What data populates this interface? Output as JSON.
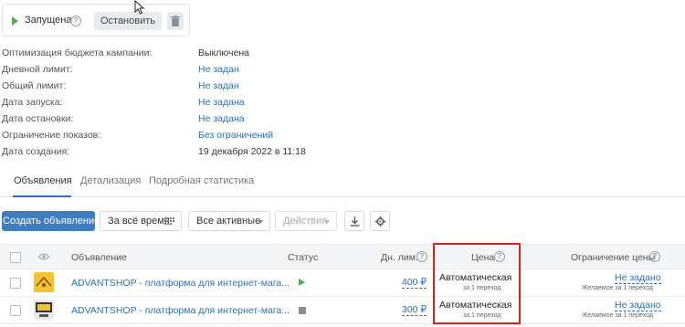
{
  "status": {
    "label": "Запущена",
    "help_icon": "?",
    "stop_label": "Остановить",
    "trash_icon": "trash-icon",
    "play_color": "#4caf50"
  },
  "info": [
    {
      "key": "Оптимизация бюджета кампании:",
      "value": "Выключена",
      "link": false
    },
    {
      "key": "Дневной лимит:",
      "value": "Не задан",
      "link": true
    },
    {
      "key": "Общий лимит:",
      "value": "Не задан",
      "link": true
    },
    {
      "key": "Дата запуска:",
      "value": "Не задана",
      "link": true
    },
    {
      "key": "Дата остановки:",
      "value": "Не задана",
      "link": true
    },
    {
      "key": "Ограничение показов:",
      "value": "Без ограничений",
      "link": true
    },
    {
      "key": "Дата создания:",
      "value": "19 декабря 2022 в 11:18",
      "link": false
    }
  ],
  "tabs": [
    "Объявления",
    "Детализация",
    "Подробная статистика"
  ],
  "toolbar": {
    "create_label": "Создать объявление",
    "period_label": "За всё время",
    "filter_label": "Все активные",
    "actions_label": "Действия"
  },
  "table": {
    "headers": {
      "ad": "Объявление",
      "status": "Статус",
      "daily_limit": "Дн. лим.",
      "price": "Цена",
      "price_limit": "Ограничение цены"
    },
    "rows": [
      {
        "title": "ADVANTSHOP - платформа для интернет-мага...",
        "status": "running",
        "limit": "400 ₽",
        "price": "Автоматическая",
        "price_note": "за 1 переход",
        "restriction": "Не задано",
        "restriction_note": "Желаемое за 1 переход"
      },
      {
        "title": "ADVANTSHOP - платформа для интернет-мага...",
        "status": "stopped",
        "limit": "300 ₽",
        "price": "Автоматическая",
        "price_note": "за 1 переход",
        "restriction": "Не задано",
        "restriction_note": "Желаемое за 1 переход"
      }
    ]
  },
  "colors": {
    "accent": "#3f7cc0",
    "link": "#2f6fb6",
    "highlight": "#e0201e"
  }
}
